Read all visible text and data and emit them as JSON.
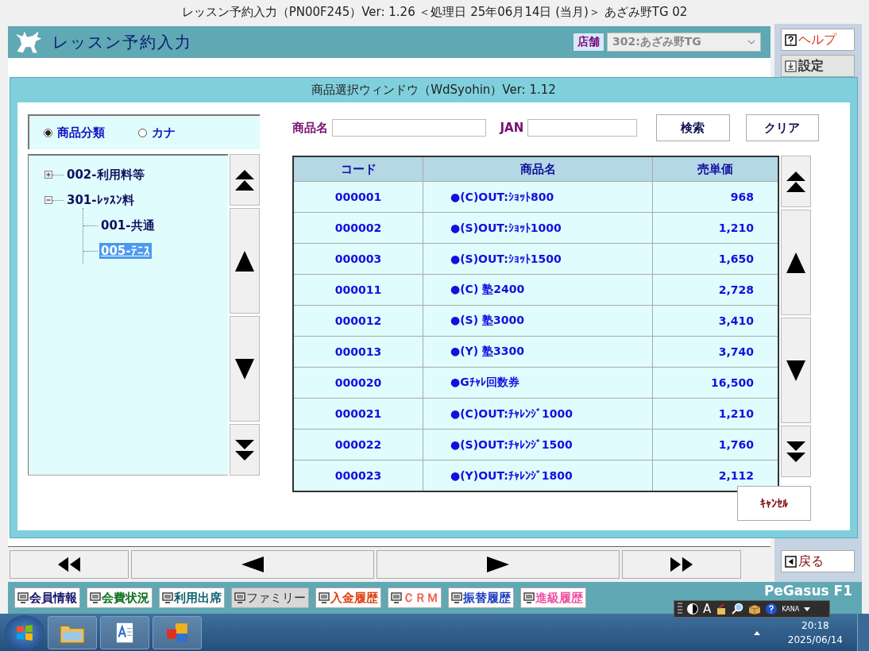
{
  "window": {
    "title": "レッスン予約入力（PN00F245）Ver: 1.26 ＜処理日 25年06月14日 (当月)＞ あざみ野TG 02"
  },
  "header": {
    "title": "レッスン予約入力",
    "store_label": "店舗",
    "store_value": "302:あざみ野TG"
  },
  "side_buttons": [
    {
      "label": "ヘルプ",
      "kind": "help"
    },
    {
      "label": "設定",
      "kind": "settings"
    }
  ],
  "back_button": {
    "label": "戻る"
  },
  "dialog": {
    "title": "商品選択ウィンドウ（WdSyohin）Ver: 1.12",
    "search_mode": [
      {
        "label": "商品分類",
        "selected": true
      },
      {
        "label": "カナ",
        "selected": false
      }
    ],
    "tree": [
      {
        "label": "002-利用料等",
        "expanded": false,
        "selected": false
      },
      {
        "label": "301-ﾚｯｽﾝ料",
        "expanded": true,
        "selected": false,
        "children": [
          {
            "label": "001-共通",
            "selected": false
          },
          {
            "label": "005-ﾃﾆｽ",
            "selected": true
          }
        ]
      }
    ],
    "search_fields": [
      {
        "label": "商品名"
      },
      {
        "label": "JAN"
      }
    ],
    "search_button": "検索",
    "clear_button": "クリア",
    "table": {
      "columns": [
        "コード",
        "商品名",
        "売単価"
      ],
      "rows": [
        [
          "000001",
          "●(C)OUT:ｼｮｯﾄ800",
          "968"
        ],
        [
          "000002",
          "●(S)OUT:ｼｮｯﾄ1000",
          "1,210"
        ],
        [
          "000003",
          "●(S)OUT:ｼｮｯﾄ1500",
          "1,650"
        ],
        [
          "000011",
          "●(C) 塾2400",
          "2,728"
        ],
        [
          "000012",
          "●(S) 塾3000",
          "3,410"
        ],
        [
          "000013",
          "●(Y) 塾3300",
          "3,740"
        ],
        [
          "000020",
          "●Gﾁｬﾚ回数券",
          "16,500"
        ],
        [
          "000021",
          "●(C)OUT:ﾁｬﾚﾝｼﾞ1000",
          "1,210"
        ],
        [
          "000022",
          "●(S)OUT:ﾁｬﾚﾝｼﾞ1500",
          "1,760"
        ],
        [
          "000023",
          "●(Y)OUT:ﾁｬﾚﾝｼﾞ1800",
          "2,112"
        ]
      ]
    },
    "cancel_button": "ｷｬﾝｾﾙ"
  },
  "bottom_tabs": [
    {
      "label": "会員情報",
      "color": "#10106a",
      "disabled": false
    },
    {
      "label": "会費状況",
      "color": "#107020",
      "disabled": false
    },
    {
      "label": "利用出席",
      "color": "#106070",
      "disabled": false
    },
    {
      "label": "ファミリー",
      "color": "#303030",
      "disabled": true
    },
    {
      "label": "入金履歴",
      "color": "#e04010",
      "disabled": false
    },
    {
      "label": "ＣＲＭ",
      "color": "#f06050",
      "disabled": false
    },
    {
      "label": "振替履歴",
      "color": "#2040c0",
      "disabled": false
    },
    {
      "label": "進級履歴",
      "color": "#f050a0",
      "disabled": false
    }
  ],
  "brand": "PeGasus F1",
  "ime_toolbar": {
    "mode": "A",
    "kana": "KANA"
  },
  "taskbar": {
    "time": "20:18",
    "date": "2025/06/14"
  }
}
